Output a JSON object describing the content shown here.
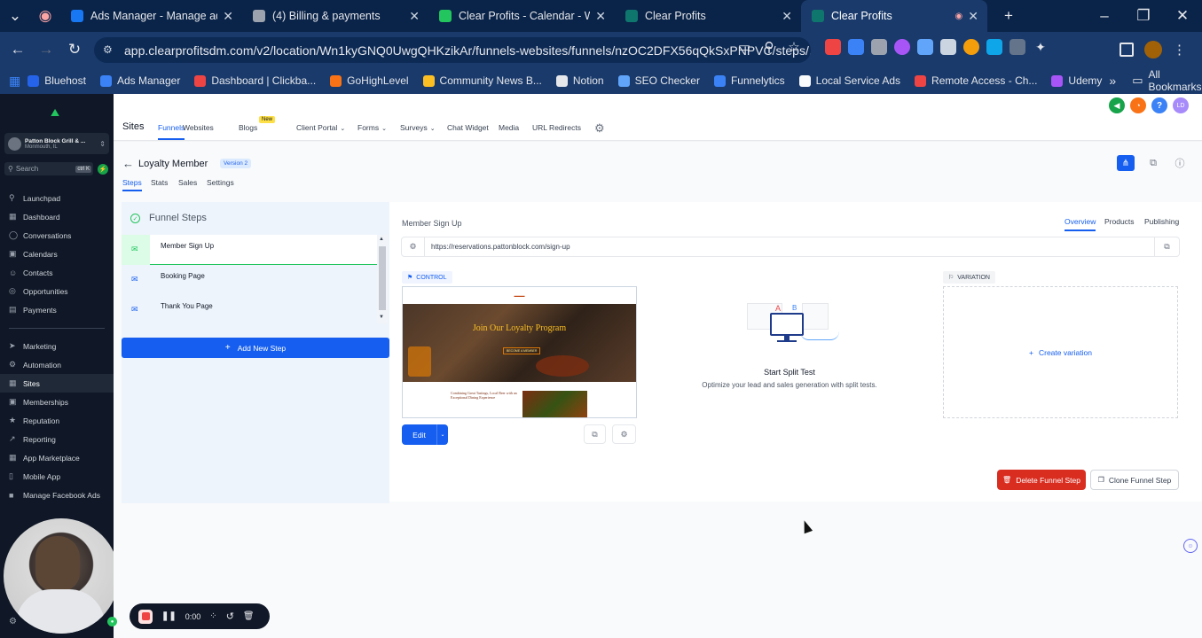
{
  "browser": {
    "tabs": [
      {
        "title": "Ads Manager - Manage ads - A",
        "fav": "#1877f2"
      },
      {
        "title": "(4) Billing & payments",
        "fav": "#9ca3af"
      },
      {
        "title": "Clear Profits - Calendar - Week",
        "fav": "#22c55e"
      },
      {
        "title": "Clear Profits",
        "fav": "#0f766e"
      },
      {
        "title": "Clear Profits",
        "fav": "#0f766e"
      }
    ],
    "url": "app.clearprofitsdm.com/v2/location/Wn1kyGNQ0UwgQHKzikAr/funnels-websites/funnels/nzOC2DFX56qQkSxPNPVC/steps/...",
    "bookmarks": [
      {
        "label": "Bluehost",
        "color": "#2563eb"
      },
      {
        "label": "Ads Manager",
        "color": "#3b82f6"
      },
      {
        "label": "Dashboard | Clickba...",
        "color": "#ef4444"
      },
      {
        "label": "GoHighLevel",
        "color": "#f97316"
      },
      {
        "label": "Community News B...",
        "color": "#fbbf24"
      },
      {
        "label": "Notion",
        "color": "#e5e7eb"
      },
      {
        "label": "SEO Checker",
        "color": "#60a5fa"
      },
      {
        "label": "Funnelytics",
        "color": "#3b82f6"
      },
      {
        "label": "Local Service Ads",
        "color": "#f8fafc"
      },
      {
        "label": "Remote Access - Ch...",
        "color": "#ef4444"
      },
      {
        "label": "Udemy",
        "color": "#a855f7"
      }
    ],
    "all_bookmarks": "All Bookmarks"
  },
  "sidebar": {
    "location_name": "Patton Block Grill & ...",
    "location_city": "Monmouth, IL",
    "search_placeholder": "Search",
    "search_shortcut": "ctrl K",
    "items_top": [
      {
        "label": "Launchpad",
        "icon": "⚲"
      },
      {
        "label": "Dashboard",
        "icon": "▦"
      },
      {
        "label": "Conversations",
        "icon": "◯"
      },
      {
        "label": "Calendars",
        "icon": "▣"
      },
      {
        "label": "Contacts",
        "icon": "☺"
      },
      {
        "label": "Opportunities",
        "icon": "◎"
      },
      {
        "label": "Payments",
        "icon": "▤"
      }
    ],
    "items_bottom": [
      {
        "label": "Marketing",
        "icon": "➤"
      },
      {
        "label": "Automation",
        "icon": "⚙"
      },
      {
        "label": "Sites",
        "icon": "▦"
      },
      {
        "label": "Memberships",
        "icon": "▣"
      },
      {
        "label": "Reputation",
        "icon": "★"
      },
      {
        "label": "Reporting",
        "icon": "↗"
      },
      {
        "label": "App Marketplace",
        "icon": "▦"
      },
      {
        "label": "Mobile App",
        "icon": "▯"
      },
      {
        "label": "Manage Facebook Ads",
        "icon": "■"
      }
    ],
    "active": "Sites"
  },
  "topnav": {
    "section": "Sites",
    "items": [
      "Funnels",
      "Websites",
      "Blogs",
      "Client Portal",
      "Forms",
      "Surveys",
      "Chat Widget",
      "Media",
      "URL Redirects"
    ],
    "new_badge": "New",
    "avatar": "LD"
  },
  "funnel": {
    "name": "Loyalty Member",
    "version": "Version 2",
    "subtabs": [
      "Steps",
      "Stats",
      "Sales",
      "Settings"
    ],
    "steps_title": "Funnel Steps",
    "steps": [
      "Member Sign Up",
      "Booking Page",
      "Thank You Page"
    ],
    "add_step": "Add New Step"
  },
  "step": {
    "title": "Member Sign Up",
    "tabs": [
      "Overview",
      "Products",
      "Publishing"
    ],
    "url": "https://reservations.pattonblock.com/sign-up",
    "control_label": "CONTROL",
    "variation_label": "VARIATION",
    "preview_heading": "Join Our Loyalty Program",
    "preview_button": "BECOME A MEMBER",
    "preview_sub": "Combining Great Tastings, Local Beer with an Exceptional Dining Experience",
    "edit": "Edit",
    "split_title": "Start Split Test",
    "split_desc": "Optimize your lead and sales generation with split tests.",
    "create_variation": "Create variation",
    "delete": "Delete Funnel Step",
    "clone": "Clone Funnel Step"
  },
  "recorder": {
    "time": "0:00"
  },
  "colors": {
    "primary": "#155eef",
    "danger": "#d92d20",
    "sidebar": "#101827",
    "panel_bg": "#eef4fb"
  }
}
